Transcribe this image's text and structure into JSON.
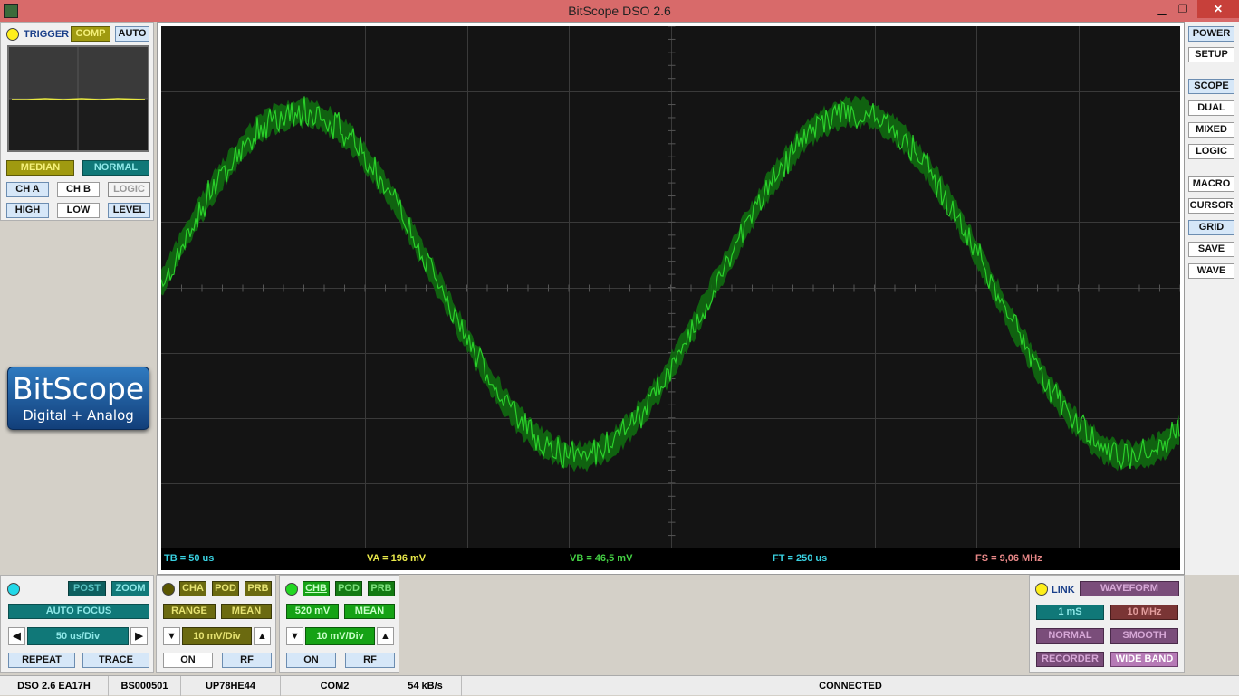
{
  "window": {
    "title": "BitScope DSO 2.6",
    "minimize": "▁",
    "restore": "❐",
    "close": "✕"
  },
  "trigger": {
    "label": "TRIGGER",
    "comp": "COMP",
    "auto": "AUTO",
    "median": "MEDIAN",
    "normal": "NORMAL",
    "cha": "CH A",
    "chb": "CH B",
    "logic": "LOGIC",
    "high": "HIGH",
    "low": "LOW",
    "level": "LEVEL"
  },
  "logo": {
    "line1": "BitScope",
    "line2": "Digital + Analog"
  },
  "right_menu": {
    "power": "POWER",
    "setup": "SETUP",
    "scope": "SCOPE",
    "dual": "DUAL",
    "mixed": "MIXED",
    "logic": "LOGIC",
    "macro": "MACRO",
    "cursor": "CURSOR",
    "grid": "GRID",
    "save": "SAVE",
    "wave": "WAVE"
  },
  "readout": {
    "tb": "TB = 50 us",
    "va": "VA = 196 mV",
    "vb": "VB = 46,5 mV",
    "ft": "FT = 250 us",
    "fs": "FS = 9,06 MHz"
  },
  "timebase": {
    "post": "POST",
    "zoom": "ZOOM",
    "auto_focus": "AUTO FOCUS",
    "value": "50 us/Div",
    "repeat": "REPEAT",
    "trace": "TRACE"
  },
  "channel_a": {
    "cha": "CHA",
    "pod": "POD",
    "prb": "PRB",
    "range": "RANGE",
    "mean": "MEAN",
    "scale": "10 mV/Div",
    "on": "ON",
    "rf": "RF"
  },
  "channel_b": {
    "chb": "CHB",
    "pod": "POD",
    "prb": "PRB",
    "range": "520 mV",
    "mean": "MEAN",
    "scale": "10 mV/Div",
    "on": "ON",
    "rf": "RF"
  },
  "link_panel": {
    "link": "LINK",
    "waveform": "WAVEFORM",
    "ms": "1 mS",
    "mhz": "10 MHz",
    "normal": "NORMAL",
    "smooth": "SMOOTH",
    "recorder": "RECORDER",
    "wide_band": "WIDE BAND"
  },
  "statusbar": {
    "version": "DSO 2.6 EA17H",
    "serial": "BS000501",
    "id": "UP78HE44",
    "port": "COM2",
    "rate": "54 kB/s",
    "state": "CONNECTED"
  },
  "colors": {
    "trace": "#2bd12b",
    "grid": "#3a3a3a",
    "tb": "#39d0e0",
    "va": "#e8e84a",
    "vb": "#44d044",
    "ft": "#39d0e0",
    "fs": "#e88888"
  }
}
